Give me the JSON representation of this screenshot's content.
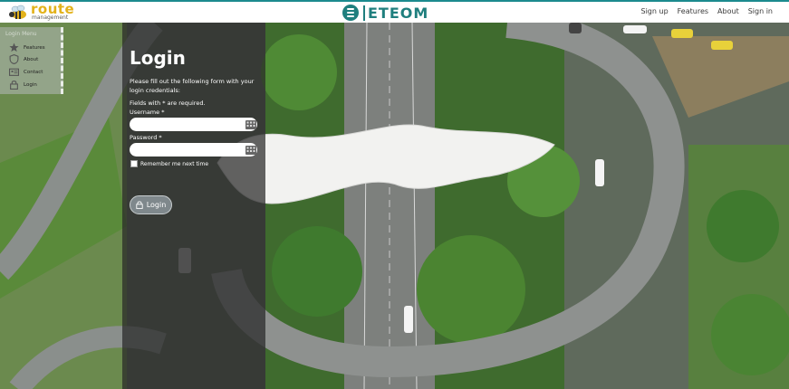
{
  "header": {
    "logo_left": {
      "word": "route",
      "tagline": "management"
    },
    "brand": {
      "name": "ETEOM"
    },
    "nav": [
      "Sign up",
      "Features",
      "About",
      "Sign in"
    ],
    "accent_color": "#1c8a8e"
  },
  "sidebar": {
    "title": "Login Menu",
    "items": [
      {
        "label": "Features",
        "icon": "star-icon"
      },
      {
        "label": "About",
        "icon": "info-shield-icon"
      },
      {
        "label": "Contact",
        "icon": "contact-card-icon"
      },
      {
        "label": "Login",
        "icon": "lock-icon"
      }
    ]
  },
  "login": {
    "title": "Login",
    "intro": "Please fill out the following form with your login credentials:",
    "required_note": "Fields with * are required.",
    "username_label": "Username *",
    "username_value": "",
    "password_label": "Password *",
    "password_value": "",
    "remember_label": "Remember me next time",
    "button_label": "Login"
  }
}
